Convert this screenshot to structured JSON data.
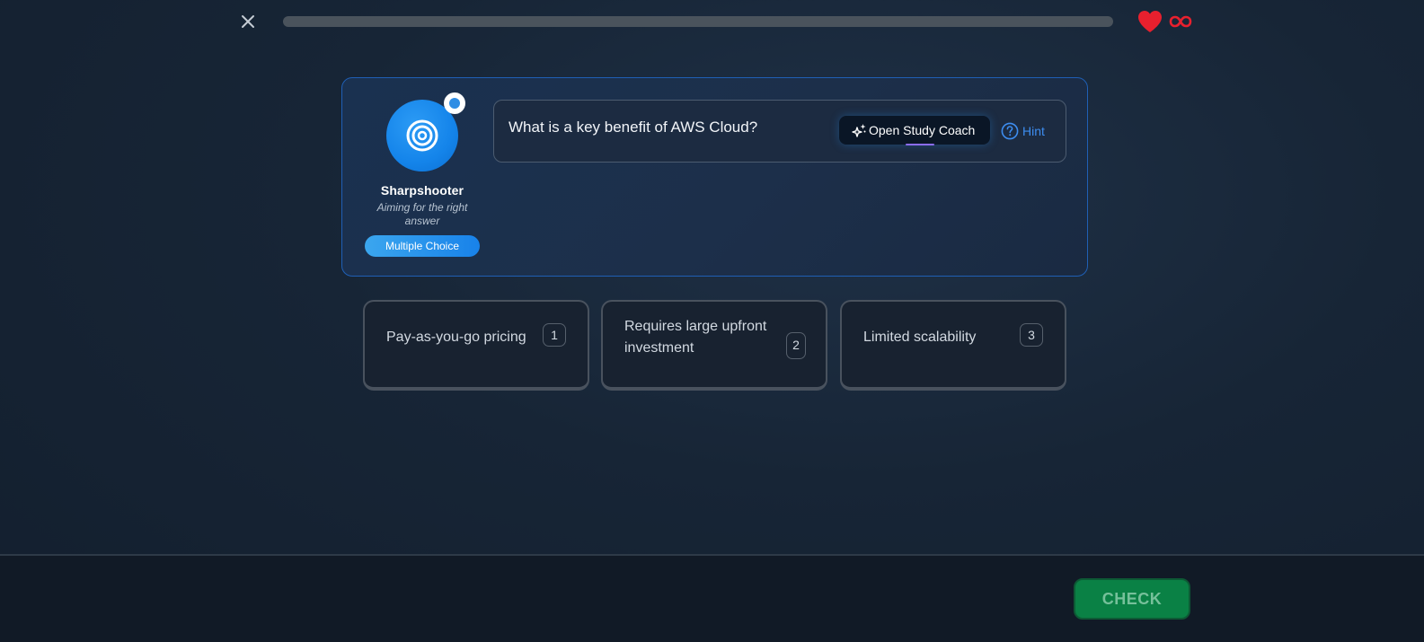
{
  "top_bar": {
    "close_icon": "close-icon",
    "progress_percent": 0,
    "lives_icon": "heart-icon",
    "lives_value_icon": "infinity-icon",
    "lives_color": "#e8202e",
    "progress_track_color": "#4a535c"
  },
  "persona": {
    "icon": "target-icon",
    "name": "Sharpshooter",
    "tagline": "Aiming for the right answer",
    "mode_label": "Multiple Choice"
  },
  "question": {
    "text": "What is a key benefit of AWS Cloud?",
    "coach_button_label": "Open Study Coach",
    "coach_icon": "sparkles-icon",
    "hint_label": "Hint",
    "hint_icon": "question-circle-icon",
    "hint_color": "#3d8df0"
  },
  "options": [
    {
      "label": "Pay-as-you-go pricing",
      "key": "1"
    },
    {
      "label": "Requires large upfront investment",
      "key": "2"
    },
    {
      "label": "Limited scalability",
      "key": "3"
    }
  ],
  "footer": {
    "check_label": "CHECK",
    "check_color": "#0a8145"
  }
}
